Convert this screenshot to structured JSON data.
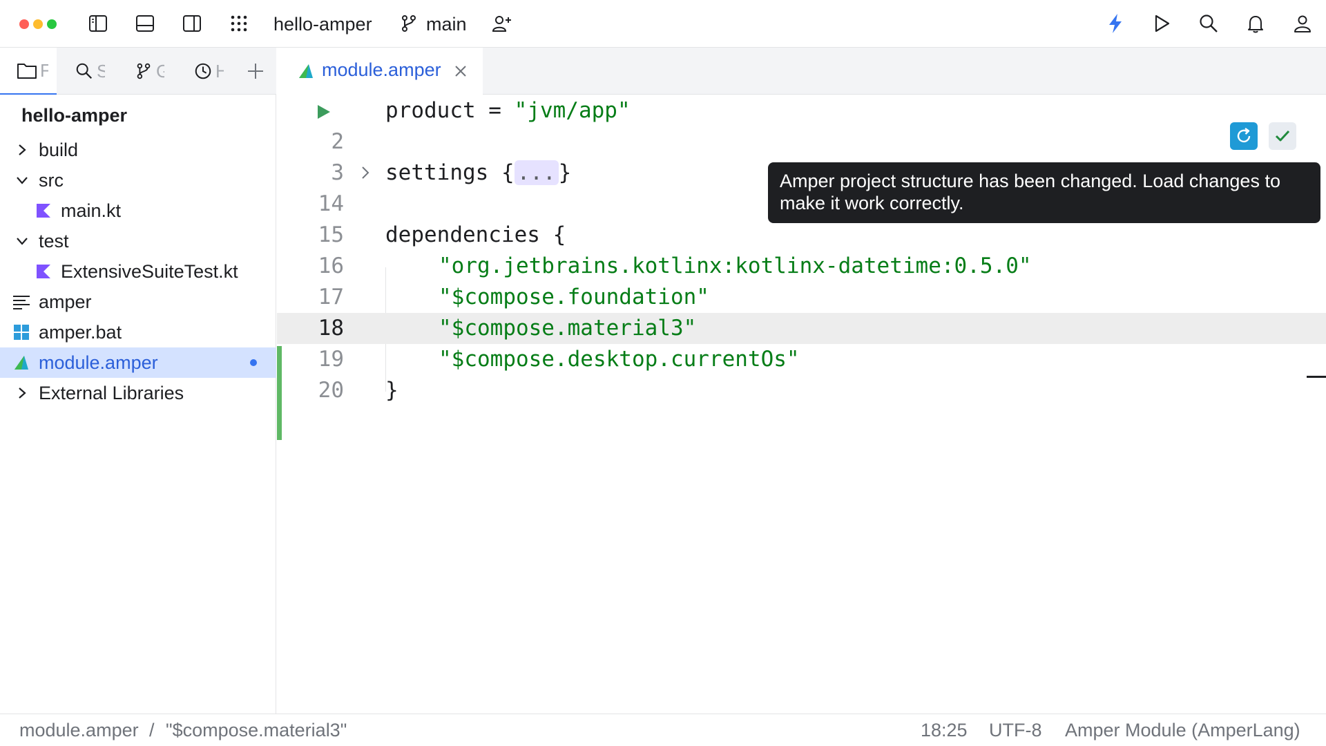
{
  "titlebar": {
    "project_name": "hello-amper",
    "branch": "main"
  },
  "left_pane": {
    "tabs": [
      {
        "label": "F",
        "icon": "folder-icon"
      },
      {
        "label": "S",
        "icon": "search-icon"
      },
      {
        "label": "G",
        "icon": "git-branch-icon"
      },
      {
        "label": "H",
        "icon": "clock-icon"
      }
    ],
    "project_title": "hello-amper",
    "tree": [
      {
        "label": "build",
        "icon": "chevron-right-icon"
      },
      {
        "label": "src",
        "icon": "chevron-down-icon"
      },
      {
        "label": "main.kt",
        "icon": "kotlin-file-icon"
      },
      {
        "label": "test",
        "icon": "chevron-down-icon"
      },
      {
        "label": "ExtensiveSuiteTest.kt",
        "icon": "kotlin-file-icon"
      },
      {
        "label": "amper",
        "icon": "text-file-icon"
      },
      {
        "label": "amper.bat",
        "icon": "windows-icon"
      },
      {
        "label": "module.amper",
        "icon": "amper-icon"
      },
      {
        "label": "External Libraries",
        "icon": "chevron-right-icon"
      }
    ]
  },
  "editor": {
    "tab_label": "module.amper",
    "lines": [
      {
        "num": "",
        "kw": "product = ",
        "str": "\"jvm/app\""
      },
      {
        "num": "2"
      },
      {
        "num": "3",
        "kw": "settings {",
        "placeholder": "...",
        "end": "}"
      },
      {
        "num": "14"
      },
      {
        "num": "15",
        "kw": "dependencies {"
      },
      {
        "num": "16",
        "str": "\"org.jetbrains.kotlinx:kotlinx-datetime:0.5.0\""
      },
      {
        "num": "17",
        "str": "\"$compose.foundation\""
      },
      {
        "num": "18",
        "str": "\"$compose.material3\""
      },
      {
        "num": "19",
        "str": "\"$compose.desktop.currentOs\""
      },
      {
        "num": "20",
        "kw": "}"
      }
    ],
    "tooltip": "Amper project structure has been changed. Load changes to make it work correctly."
  },
  "statusbar": {
    "breadcrumb_file": "module.amper",
    "breadcrumb_sep": "/",
    "breadcrumb_item": "\"$compose.material3\"",
    "position": "18:25",
    "encoding": "UTF-8",
    "file_type": "Amper Module (AmperLang)"
  },
  "colors": {
    "accent": "#3574f0",
    "string": "#067d17",
    "change_marker": "#5fb865",
    "tooltip_bg": "#1e1f22"
  }
}
